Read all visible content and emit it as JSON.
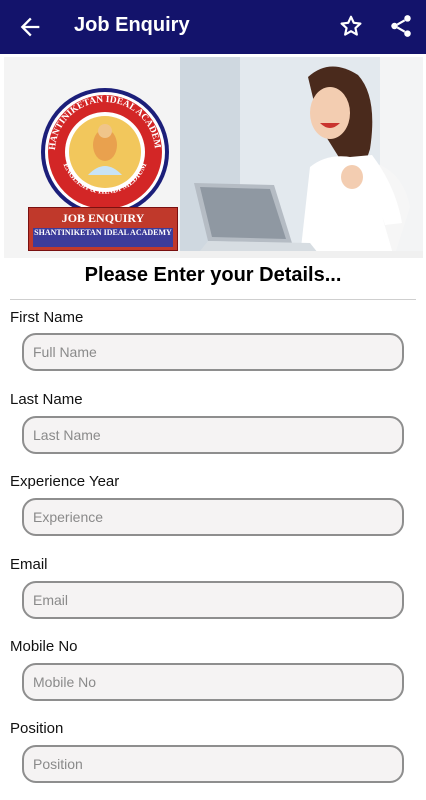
{
  "appbar": {
    "title": "Job Enquiry",
    "back_icon": "arrow-left-icon",
    "star_icon": "star-icon",
    "share_icon": "share-icon",
    "background_color": "#13136b"
  },
  "banner": {
    "seal_outer_text": "SHANTINIKETAN IDEAL ACADEMY",
    "seal_inner_text": "ENGLISH & HINDI MEDIUM",
    "enquiry_title": "JOB ENQUIRY",
    "enquiry_subtitle": "SHANTINIKETAN IDEAL ACADEMY"
  },
  "form": {
    "heading": "Please Enter your Details...",
    "fields": [
      {
        "label": "First Name",
        "placeholder": "Full Name"
      },
      {
        "label": "Last Name",
        "placeholder": "Last Name"
      },
      {
        "label": "Experience Year",
        "placeholder": "Experience"
      },
      {
        "label": "Email",
        "placeholder": "Email"
      },
      {
        "label": "Mobile No",
        "placeholder": "Mobile No"
      },
      {
        "label": "Position",
        "placeholder": "Position"
      }
    ]
  }
}
